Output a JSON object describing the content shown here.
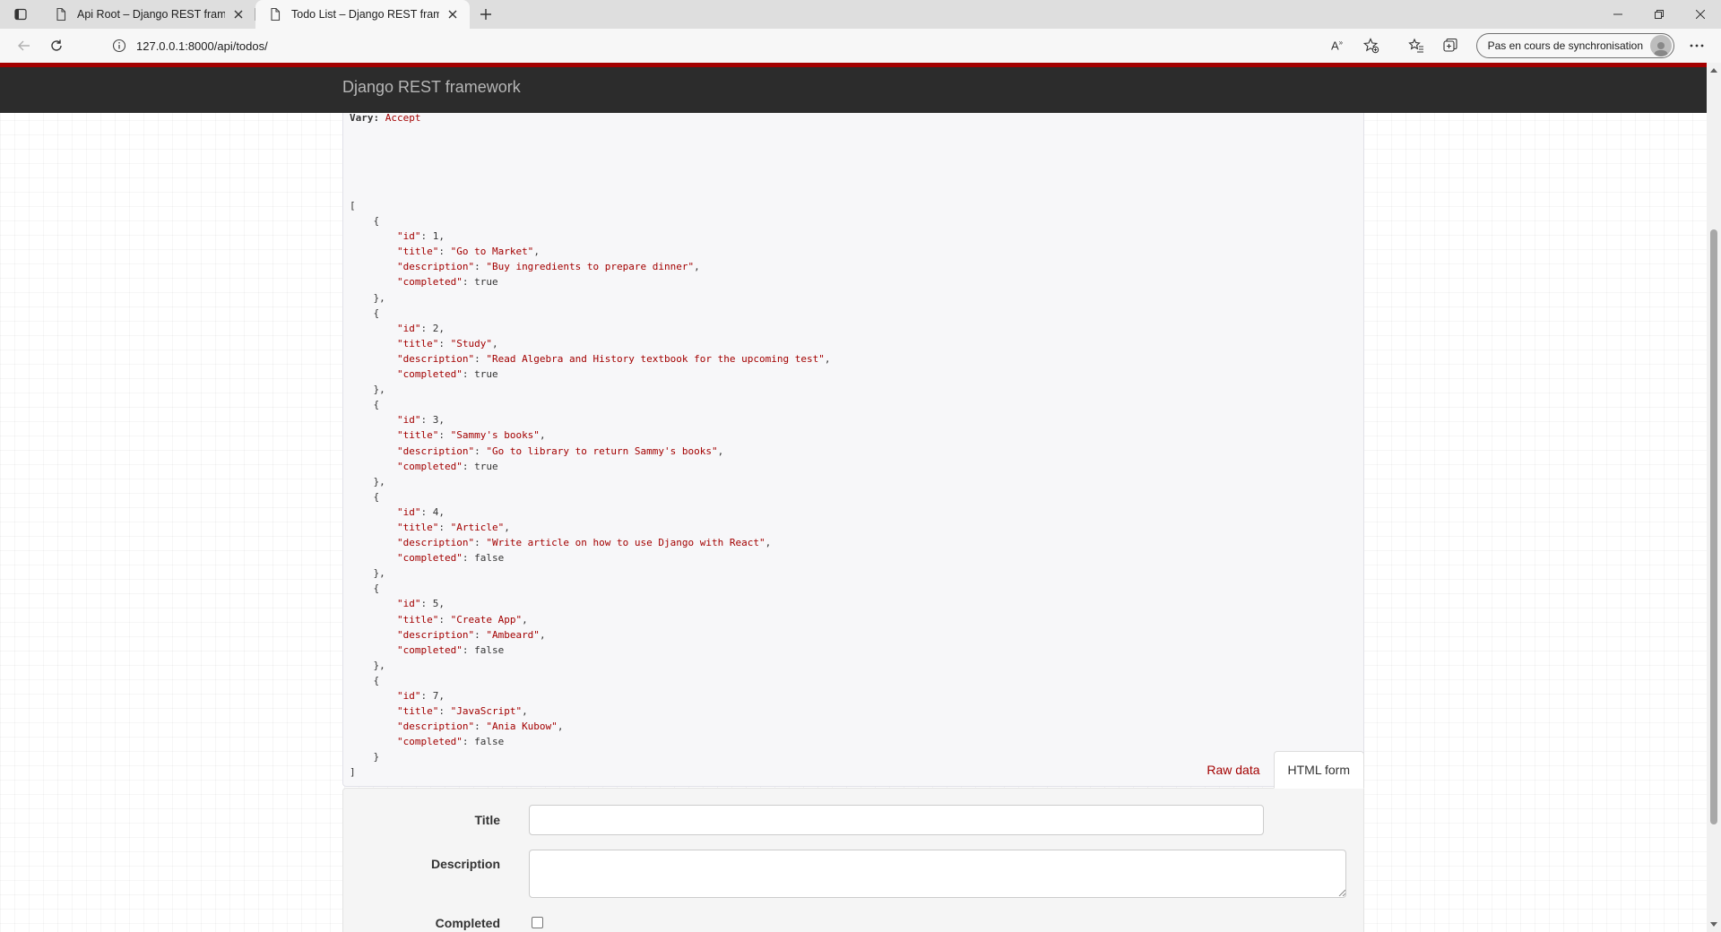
{
  "browser": {
    "tabs": [
      {
        "title": "Api Root – Django REST framewo",
        "active": false
      },
      {
        "title": "Todo List – Django REST framewo",
        "active": true
      }
    ],
    "url": "127.0.0.1:8000/api/todos/",
    "sync_label": "Pas en cours de synchronisation",
    "read_aloud_label": "A"
  },
  "page": {
    "brand": "Django REST framework",
    "response_header_key": "Vary:",
    "response_header_value": "Accept",
    "todos": [
      {
        "id": "1",
        "title": "\"Go to Market\"",
        "description": "\"Buy ingredients to prepare dinner\"",
        "completed": "true"
      },
      {
        "id": "2",
        "title": "\"Study\"",
        "description": "\"Read Algebra and History textbook for the upcoming test\"",
        "completed": "true"
      },
      {
        "id": "3",
        "title": "\"Sammy's books\"",
        "description": "\"Go to library to return Sammy's books\"",
        "completed": "true"
      },
      {
        "id": "4",
        "title": "\"Article\"",
        "description": "\"Write article on how to use Django with React\"",
        "completed": "false"
      },
      {
        "id": "5",
        "title": "\"Create App\"",
        "description": "\"Ambeard\"",
        "completed": "false"
      },
      {
        "id": "7",
        "title": "\"JavaScript\"",
        "description": "\"Ania Kubow\"",
        "completed": "false"
      }
    ],
    "json_keys": {
      "id": "\"id\"",
      "title": "\"title\"",
      "description": "\"description\"",
      "completed": "\"completed\""
    },
    "form": {
      "tab_raw": "Raw data",
      "tab_html": "HTML form",
      "title_label": "Title",
      "description_label": "Description",
      "completed_label": "Completed",
      "title_value": "",
      "description_value": "",
      "completed_checked": false
    }
  },
  "colors": {
    "accent": "#a30000",
    "navbar": "#2c2c2c"
  }
}
